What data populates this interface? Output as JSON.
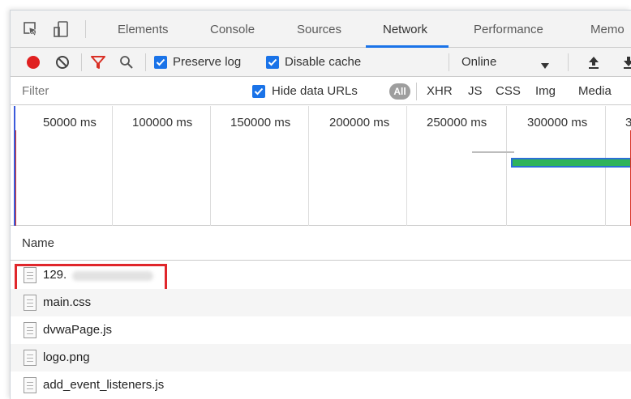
{
  "tabs": {
    "elements": "Elements",
    "console": "Console",
    "sources": "Sources",
    "network": "Network",
    "performance": "Performance",
    "memory": "Memo"
  },
  "toolbar": {
    "preserve_log": "Preserve log",
    "preserve_log_checked": true,
    "disable_cache": "Disable cache",
    "disable_cache_checked": true,
    "throttling": "Online"
  },
  "filter": {
    "placeholder": "Filter",
    "hide_data_urls": "Hide data URLs",
    "hide_data_urls_checked": true,
    "types": [
      "All",
      "XHR",
      "JS",
      "CSS",
      "Img",
      "Media"
    ]
  },
  "overview": {
    "ticks": [
      "50000 ms",
      "100000 ms",
      "150000 ms",
      "200000 ms",
      "250000 ms",
      "300000 ms",
      "3"
    ]
  },
  "requests": {
    "column_name": "Name",
    "rows": [
      {
        "name": "129.",
        "redacted": true
      },
      {
        "name": "main.css"
      },
      {
        "name": "dvwaPage.js"
      },
      {
        "name": "logo.png"
      },
      {
        "name": "add_event_listeners.js"
      }
    ]
  },
  "colors": {
    "record": "#e02020",
    "accent": "#1a73e8",
    "filter_icon": "#d93025",
    "highlight": "#e0262b",
    "bar_fill": "#2fb35b"
  },
  "icons": {
    "inspect": "inspect-element-icon",
    "device": "device-toolbar-icon",
    "record": "record-icon",
    "clear": "clear-icon",
    "filter": "filter-icon",
    "search": "search-icon",
    "dropdown": "chevron-down-icon",
    "import": "import-har-icon",
    "export": "export-har-icon",
    "file": "file-icon"
  }
}
